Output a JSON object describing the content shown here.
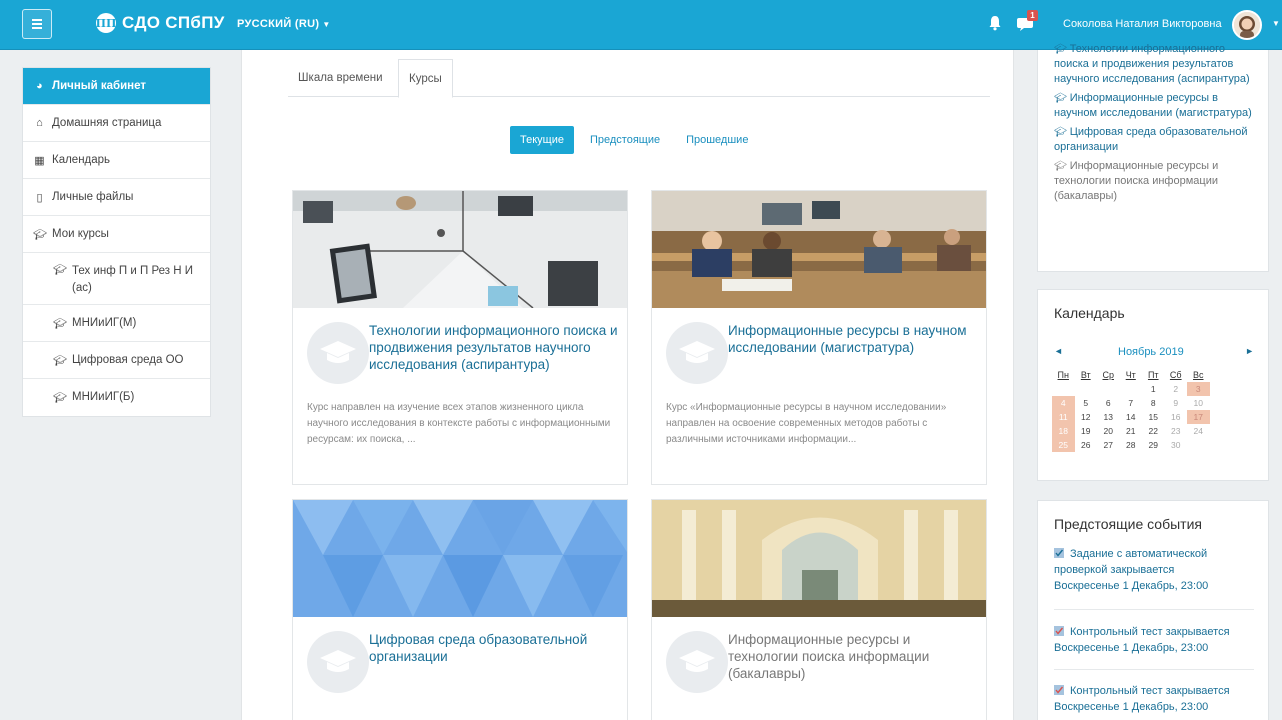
{
  "navbar": {
    "brand": "СДО СПбПУ",
    "brand_logo": "ПП",
    "language": "РУССКИЙ (RU)",
    "notification_badge": "1",
    "username": "Соколова Наталия Викторовна"
  },
  "sidebar": {
    "items": [
      {
        "label": "Личный кабинет",
        "icon": "dashboard-icon"
      },
      {
        "label": "Домашняя страница",
        "icon": "home-icon"
      },
      {
        "label": "Календарь",
        "icon": "calendar-icon"
      },
      {
        "label": "Личные файлы",
        "icon": "file-icon"
      },
      {
        "label": "Мои курсы",
        "icon": "graduation-cap-icon"
      },
      {
        "label": "Тех инф П и П Рез Н И (ас)",
        "icon": "graduation-cap-icon"
      },
      {
        "label": "МНИиИГ(М)",
        "icon": "graduation-cap-icon"
      },
      {
        "label": "Цифровая среда ОО",
        "icon": "graduation-cap-icon"
      },
      {
        "label": "МНИиИГ(Б)",
        "icon": "graduation-cap-icon"
      }
    ]
  },
  "main": {
    "tabs": [
      "Шкала времени",
      "Курсы"
    ],
    "filters": [
      "Текущие",
      "Предстоящие",
      "Прошедшие"
    ],
    "courses": [
      {
        "title": "Технологии информационного поиска и продвижения результатов научного исследования (аспирантура)",
        "description": "Курс направлен на изучение всех этапов жизненного цикла научного исследования в контексте работы с информационными ресурсам: их поиска, ..."
      },
      {
        "title": "Информационные ресурсы в научном исследовании (магистратура)",
        "description": "Курс «Информационные ресурсы в научном исследовании» направлен на освоение современных методов работы с различными источниками информации..."
      },
      {
        "title": "Цифровая среда образовательной организации",
        "description": ""
      },
      {
        "title": "Информационные ресурсы и технологии поиска информации (бакалавры)",
        "description": ""
      }
    ]
  },
  "right": {
    "my_courses": [
      {
        "label": "Технологии информационного поиска и продвижения результатов научного исследования (аспирантура)"
      },
      {
        "label": "Информационные ресурсы в научном исследовании (магистратура)"
      },
      {
        "label": "Цифровая среда образовательной организации"
      },
      {
        "label": "Информационные ресурсы и технологии поиска информации (бакалавры)"
      }
    ],
    "calendar": {
      "title": "Календарь",
      "month": "Ноябрь 2019",
      "weekdays": [
        "Пн",
        "Вт",
        "Ср",
        "Чт",
        "Пт",
        "Сб",
        "Вс"
      ],
      "weeks": [
        [
          "",
          "",
          "",
          "",
          "1",
          "2",
          "3"
        ],
        [
          "4",
          "5",
          "6",
          "7",
          "8",
          "9",
          "10"
        ],
        [
          "11",
          "12",
          "13",
          "14",
          "15",
          "16",
          "17"
        ],
        [
          "18",
          "19",
          "20",
          "21",
          "22",
          "23",
          "24"
        ],
        [
          "25",
          "26",
          "27",
          "28",
          "29",
          "30",
          ""
        ]
      ],
      "highlighted_days": [
        "3",
        "4",
        "11",
        "17",
        "18",
        "25"
      ]
    },
    "events": {
      "title": "Предстоящие события",
      "items": [
        {
          "label": "Задание с автоматической проверкой закрывается",
          "date": "Воскресенье 1 Декабрь, 23:00"
        },
        {
          "label": "Контрольный тест закрывается",
          "date": "Воскресенье 1 Декабрь, 23:00"
        },
        {
          "label": "Контрольный тест закрывается",
          "date": "Воскресенье 1 Декабрь, 23:00"
        }
      ]
    }
  },
  "colors": {
    "primary": "#1aa6d4",
    "link": "#1a6f96",
    "calendar_highlight": "#f2c4ad",
    "badge": "#d9534f"
  }
}
